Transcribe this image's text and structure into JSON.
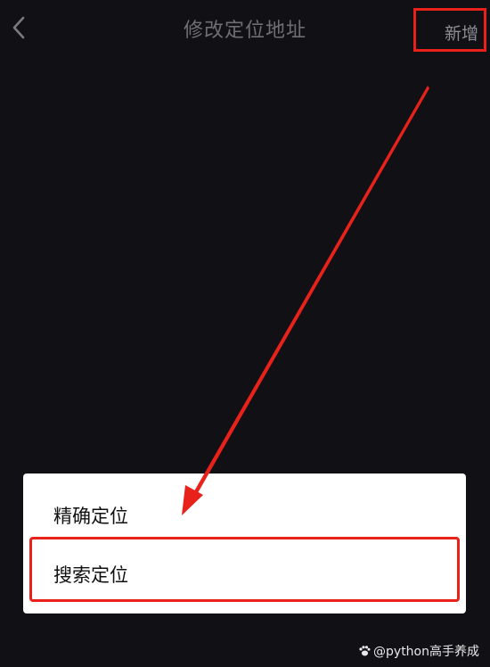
{
  "header": {
    "title": "修改定位地址",
    "add_label": "新增"
  },
  "sheet": {
    "items": [
      {
        "label": "精确定位"
      },
      {
        "label": "搜索定位"
      }
    ]
  },
  "watermark": {
    "text": "@python高手养成"
  },
  "colors": {
    "background": "#101015",
    "annotation_red": "#e8221b",
    "sheet_bg": "#ffffff"
  },
  "icons": {
    "back": "chevron-left-icon",
    "watermark": "paw-icon"
  }
}
